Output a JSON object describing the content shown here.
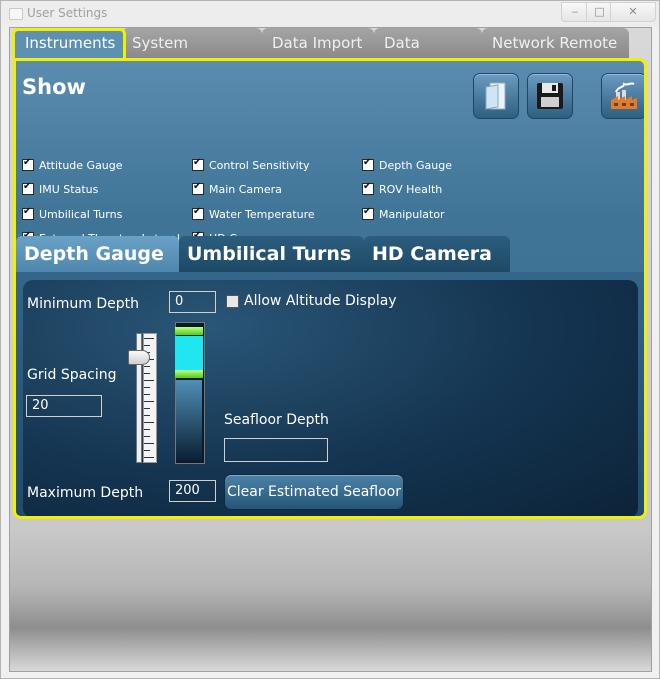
{
  "window": {
    "title": "User Settings",
    "min_glyph": "‒",
    "max_glyph": "□",
    "close_glyph": "✕"
  },
  "top_tabs": [
    {
      "label": "Instruments",
      "active": true
    },
    {
      "label": "System Settings",
      "active": false
    },
    {
      "label": "Data Import",
      "active": false
    },
    {
      "label": "Data Export",
      "active": false
    },
    {
      "label": "Network Remote",
      "active": false
    }
  ],
  "show": {
    "title": "Show",
    "icons": [
      "document-icon",
      "save-icon",
      "factory-icon"
    ],
    "checkboxes": [
      {
        "label": "Attitude Gauge",
        "checked": true
      },
      {
        "label": "IMU Status",
        "checked": true
      },
      {
        "label": "Umbilical Turns",
        "checked": true
      },
      {
        "label": "External Thruster, Lateral",
        "checked": true
      },
      {
        "label": "Control Sensitivity",
        "checked": true
      },
      {
        "label": "Main Camera",
        "checked": true
      },
      {
        "label": "Water Temperature",
        "checked": true
      },
      {
        "label": "HD Camera",
        "checked": true
      },
      {
        "label": "Depth Gauge",
        "checked": true
      },
      {
        "label": "ROV Health",
        "checked": true
      },
      {
        "label": "Manipulator",
        "checked": true
      }
    ]
  },
  "sub_tabs": [
    {
      "label": "Depth Gauge",
      "active": true
    },
    {
      "label": "Umbilical Turns",
      "active": false
    },
    {
      "label": "HD Camera",
      "active": false
    }
  ],
  "depth_gauge": {
    "min_depth_label": "Minimum Depth",
    "min_depth_value": "0",
    "allow_altitude_label": "Allow Altitude Display",
    "allow_altitude_checked": false,
    "grid_spacing_label": "Grid Spacing",
    "grid_spacing_value": "20",
    "seafloor_depth_label": "Seafloor Depth",
    "seafloor_depth_value": "",
    "max_depth_label": "Maximum Depth",
    "max_depth_value": "200",
    "clear_button_label": "Clear Estimated Seafloor"
  },
  "colors": {
    "highlight": "#f0f000",
    "panel": "#4a7ea2",
    "gauge_cyan": "#20e6f2",
    "gauge_green": "#7cf03c"
  }
}
